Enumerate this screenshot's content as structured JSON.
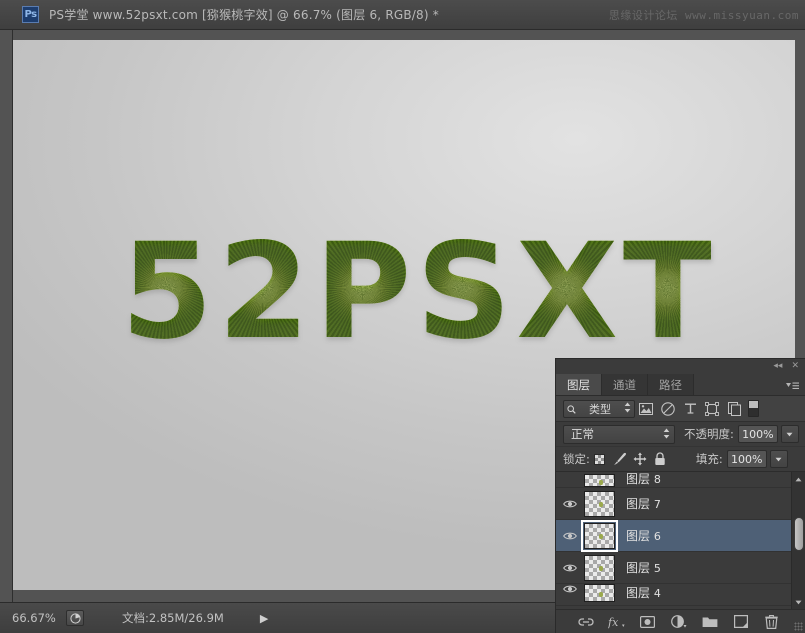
{
  "titlebar": {
    "logo_text": "Ps",
    "title": "PS学堂  www.52psxt.com [猕猴桃字效] @ 66.7% (图层 6, RGB/8) *",
    "watermark": "思缘设计论坛 www.missyuan.com"
  },
  "canvas": {
    "artwork_text": "52PSXT",
    "letters": [
      "5",
      "2",
      "P",
      "S",
      "X",
      "T"
    ],
    "background_color": "#d0d0d0"
  },
  "statusbar": {
    "zoom": "66.67%",
    "preview_icon": "preview-icon",
    "doc_size": "文档:2.85M/26.9M",
    "arrow": "▶"
  },
  "layers_panel": {
    "collapse_icon": "◂◂",
    "close_icon": "✕",
    "tabs": [
      {
        "label": "图层",
        "active": true
      },
      {
        "label": "通道",
        "active": false
      },
      {
        "label": "路径",
        "active": false
      }
    ],
    "menu_icon": "panel-menu-icon",
    "filter": {
      "search_icon": "search-icon",
      "kind_label": "类型",
      "spinner": "▴▾",
      "icons": [
        "pixel-layer-filter-icon",
        "adjustment-layer-filter-icon",
        "type-layer-filter-icon",
        "shape-layer-filter-icon",
        "smart-object-filter-icon"
      ],
      "toggle_name": "filter-enable-toggle"
    },
    "blend": {
      "mode": "正常",
      "spinner": "▴▾",
      "opacity_label": "不透明度:",
      "opacity_value": "100%",
      "opacity_arrow": "▾"
    },
    "lock": {
      "label": "锁定:",
      "icons": [
        "lock-transparency-icon",
        "lock-image-pixels-icon",
        "lock-position-icon",
        "lock-all-icon"
      ],
      "fill_label": "填充:",
      "fill_value": "100%",
      "fill_arrow": "▾"
    },
    "layers": [
      {
        "name": "图层",
        "num": "8",
        "visible": true,
        "selected": false,
        "clip": "top"
      },
      {
        "name": "图层",
        "num": "7",
        "visible": true,
        "selected": false,
        "clip": "none"
      },
      {
        "name": "图层",
        "num": "6",
        "visible": true,
        "selected": true,
        "clip": "none"
      },
      {
        "name": "图层",
        "num": "5",
        "visible": true,
        "selected": false,
        "clip": "none"
      },
      {
        "name": "图层",
        "num": "4",
        "visible": true,
        "selected": false,
        "clip": "bottom"
      }
    ],
    "scrollbar": {
      "up_arrow": "▲",
      "down_arrow": "▼"
    },
    "footer_icons": [
      "link-layers-icon",
      "layer-style-fx-icon",
      "add-layer-mask-icon",
      "new-adjustment-layer-icon",
      "new-group-icon",
      "new-layer-icon",
      "delete-layer-icon"
    ]
  }
}
